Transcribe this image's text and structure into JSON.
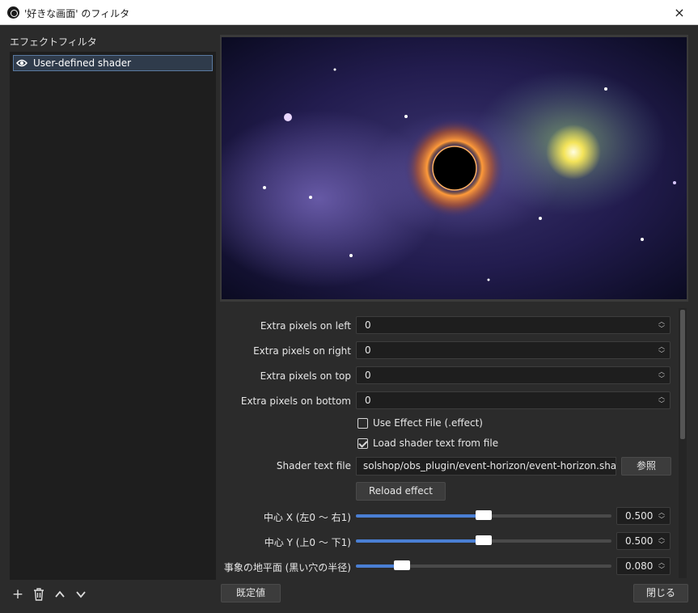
{
  "window": {
    "title": "'好きな画面' のフィルタ",
    "close_icon": "×"
  },
  "sidebar": {
    "label": "エフェクトフィルタ",
    "filters": [
      {
        "name": "User-defined shader",
        "visible": true
      }
    ],
    "toolbar": {
      "add": "+",
      "remove": "🗑",
      "up": "∧",
      "down": "∨"
    }
  },
  "properties": {
    "extra_left": {
      "label": "Extra pixels on left",
      "value": "0"
    },
    "extra_right": {
      "label": "Extra pixels on right",
      "value": "0"
    },
    "extra_top": {
      "label": "Extra pixels on top",
      "value": "0"
    },
    "extra_bottom": {
      "label": "Extra pixels on bottom",
      "value": "0"
    },
    "use_effect_file": {
      "label": "Use Effect File (.effect)",
      "checked": false
    },
    "load_shader": {
      "label": "Load shader text from file",
      "checked": true
    },
    "shader_file": {
      "label": "Shader text file",
      "value": "solshop/obs_plugin/event-horizon/event-horizon.shader",
      "browse": "参照"
    },
    "reload_button": "Reload effect",
    "center_x": {
      "label": "中心 X (左0 ～ 右1)",
      "value": "0.500",
      "fraction": 0.5
    },
    "center_y": {
      "label": "中心 Y (上0 ～ 下1)",
      "value": "0.500",
      "fraction": 0.5
    },
    "horizon": {
      "label": "事象の地平面 (黒い穴の半径)",
      "value": "0.080",
      "fraction": 0.18
    }
  },
  "footer": {
    "defaults": "既定値",
    "close": "閉じる"
  },
  "colors": {
    "accent": "#4a7fd4",
    "selection": "#2f3b4b"
  }
}
